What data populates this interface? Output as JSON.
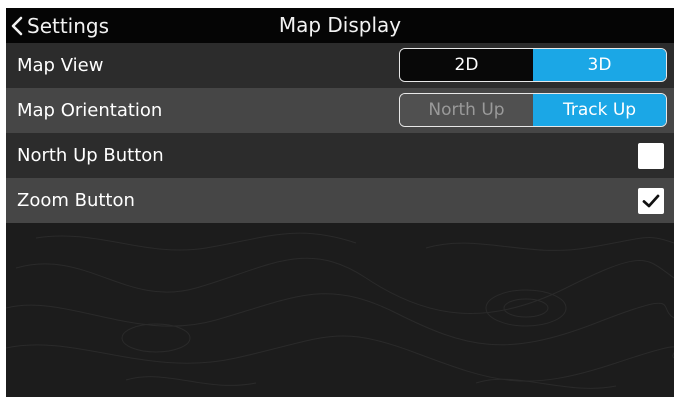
{
  "header": {
    "back_label": "Settings",
    "title": "Map Display"
  },
  "settings": {
    "map_view": {
      "label": "Map View",
      "options": [
        "2D",
        "3D"
      ],
      "selected": "3D"
    },
    "map_orientation": {
      "label": "Map Orientation",
      "options": [
        "North Up",
        "Track Up"
      ],
      "selected": "Track Up"
    },
    "north_up_button": {
      "label": "North Up Button",
      "checked": false
    },
    "zoom_button": {
      "label": "Zoom Button",
      "checked": true
    }
  },
  "colors": {
    "accent": "#1ba7e6",
    "header_bg": "#050505",
    "row_dark": "#2c2c2c",
    "row_light": "#464646",
    "background": "#1c1c1c"
  },
  "icons": {
    "back": "chevron-left-icon",
    "checkmark": "checkmark-icon",
    "background": "topographic-map-pattern"
  }
}
